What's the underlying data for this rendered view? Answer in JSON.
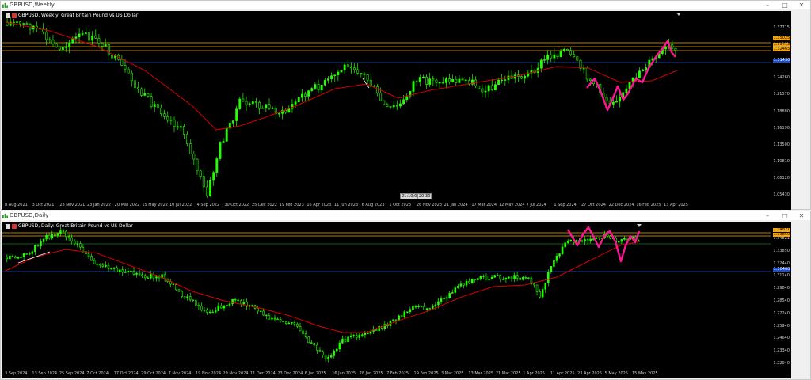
{
  "weekly": {
    "window_title": "GBPUSD,Weekly",
    "chart_header": "GBPUSD, Weekly:  Great Britain Pound vs US Dollar",
    "price_labels": [
      "1.37715",
      "1.35025",
      "1.29950",
      "1.24260",
      "1.21570",
      "1.18880",
      "1.16190",
      "1.13500",
      "1.10810",
      "1.08120",
      "1.05430"
    ],
    "price_tags": [
      {
        "text": "1.35025",
        "color": "#f6a800"
      },
      {
        "text": "1.33413",
        "color": "#f6a800"
      },
      {
        "text": "1.32465",
        "color": "#f6a800"
      },
      {
        "text": "1.31430",
        "color": "#1f4fd1"
      }
    ],
    "x_labels": [
      "8 Aug 2021",
      "3 Oct 2021",
      "28 Nov 2021",
      "23 Jan 2022",
      "20 Mar 2022",
      "15 May 2022",
      "10 Jul 2022",
      "4 Sep 2022",
      "30 Oct 2022",
      "25 Dec 2022",
      "19 Feb 2023",
      "16 Apr 2023",
      "11 Jun 2023",
      "6 Aug 2023",
      "1 Oct 2023",
      "26 Nov 2023",
      "21 Jan 2024",
      "17 Mar 2024",
      "12 May 2024",
      "7 Jul 2024",
      "1 Sep 2024",
      "27 Oct 2024",
      "22 Dec 2024",
      "16 Feb 2025",
      "13 Apr 2025"
    ],
    "crosshair_tags": [
      "21:10:00",
      "20:30"
    ]
  },
  "daily": {
    "window_title": "GBPUSD,Daily",
    "chart_header": "GBPUSD, Daily:  Great Britain Pound vs US Dollar",
    "price_labels": [
      "1.34821",
      "1.33850",
      "1.32440",
      "1.31140",
      "1.29840",
      "1.28540",
      "1.27240",
      "1.25940",
      "1.24640",
      "1.23340",
      "1.22040"
    ],
    "price_tags": [
      {
        "text": "1.34821",
        "color": "#f6a800"
      },
      {
        "text": "1.33850",
        "color": "#f6a800"
      },
      {
        "text": "1.30400",
        "color": "#1f4fd1"
      }
    ],
    "x_labels": [
      "3 Sep 2024",
      "13 Sep 2024",
      "25 Sep 2024",
      "7 Oct 2024",
      "17 Oct 2024",
      "29 Oct 2024",
      "7 Nov 2024",
      "19 Nov 2024",
      "29 Nov 2024",
      "11 Dec 2024",
      "23 Dec 2024",
      "6 Jan 2025",
      "16 Jan 2025",
      "28 Jan 2025",
      "7 Feb 2025",
      "19 Feb 2025",
      "3 Mar 2025",
      "13 Mar 2025",
      "21 Mar 2025",
      "1 Apr 2025",
      "11 Apr 2025",
      "23 Apr 2025",
      "5 May 2025",
      "15 May 2025"
    ]
  },
  "colors": {
    "candle": "#22ff00",
    "moving_average": "#d40000",
    "annotation": "#ff1493",
    "orange_level": "#f6a800",
    "blue_level": "#1f4fd1",
    "green_level": "#1a7a1a"
  }
}
